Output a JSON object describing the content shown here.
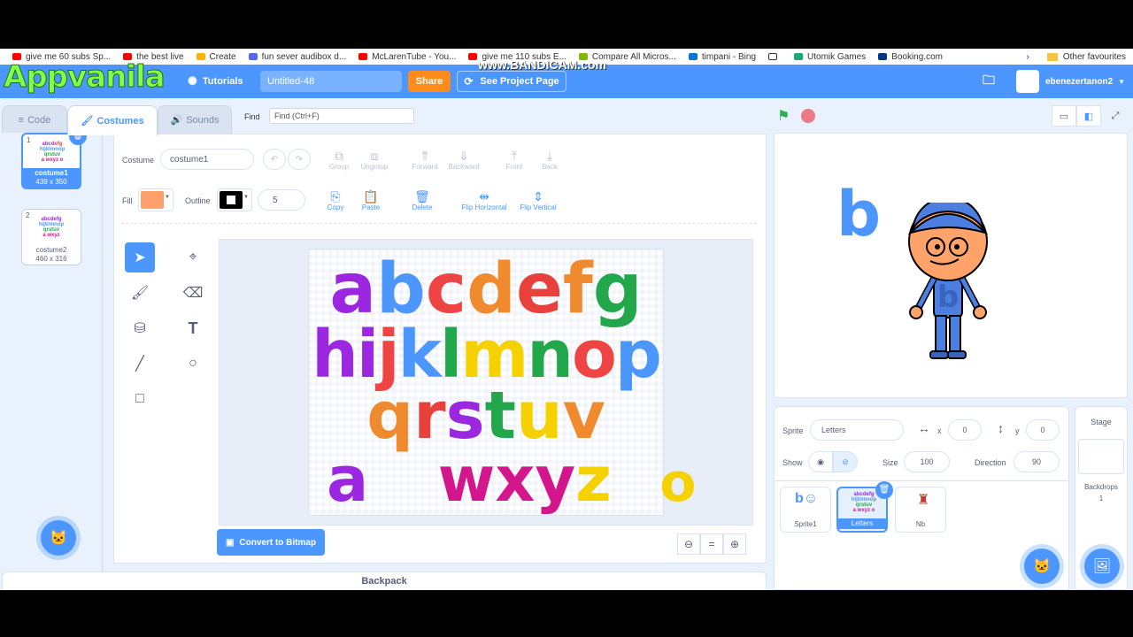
{
  "bookmarks": [
    "give me 60 subs Sp...",
    "the best live",
    "Create",
    "fun sever audibox d...",
    "McLarenTube - You...",
    "give me 110 subs E...",
    "Compare All Micros...",
    "timpani - Bing",
    "",
    "Utomik Games",
    "Booking.com"
  ],
  "bookmarks_other": "Other favourites",
  "watermark": {
    "logo": "Appvanila",
    "recorder": "www.BANDICAM.com"
  },
  "menubar": {
    "tutorials": "Tutorials",
    "project_title": "Untitled-48",
    "share": "Share",
    "see_project_page": "See Project Page",
    "username": "ebenezertanon2"
  },
  "tabs": {
    "code": "Code",
    "costumes": "Costumes",
    "sounds": "Sounds"
  },
  "find": {
    "label": "Find",
    "placeholder": "Find (Ctrl+F)"
  },
  "costumes": [
    {
      "num": "1",
      "name": "costume1",
      "size": "439 x 350"
    },
    {
      "num": "2",
      "name": "costume2",
      "size": "460 x 316"
    }
  ],
  "editor": {
    "costume_label": "Costume",
    "costume_name": "costume1",
    "fill_label": "Fill",
    "outline_label": "Outline",
    "outline_width": "5",
    "group": "Group",
    "ungroup": "Ungroup",
    "forward": "Forward",
    "backward": "Backward",
    "front": "Front",
    "back": "Back",
    "copy": "Copy",
    "paste": "Paste",
    "delete": "Delete",
    "flip_horizontal": "Flip Horizontal",
    "flip_vertical": "Flip Vertical",
    "convert_bitmap": "Convert to Bitmap",
    "fill_color": "#ff9f6b"
  },
  "canvas_letters": {
    "row1": "abcdefg",
    "row2": "hijklmnop",
    "row3": "qrstuv",
    "row4a": "a",
    "row4b": "wxyz",
    "row4c": "o"
  },
  "backpack": "Backpack",
  "stage": {
    "letter": "b",
    "shirt_letter": "b"
  },
  "sprite_info": {
    "sprite_label": "Sprite",
    "sprite_name": "Letters",
    "x_label": "x",
    "x_value": "0",
    "y_label": "y",
    "y_value": "0",
    "show_label": "Show",
    "size_label": "Size",
    "size_value": "100",
    "direction_label": "Direction",
    "direction_value": "90"
  },
  "sprites": [
    {
      "name": "Sprite1"
    },
    {
      "name": "Letters"
    },
    {
      "name": "Nb"
    }
  ],
  "stage_pane": {
    "title": "Stage",
    "backdrops_label": "Backdrops",
    "backdrops_count": "1"
  },
  "colors": {
    "accent": "#4c97ff",
    "share": "#ff8c1a"
  }
}
